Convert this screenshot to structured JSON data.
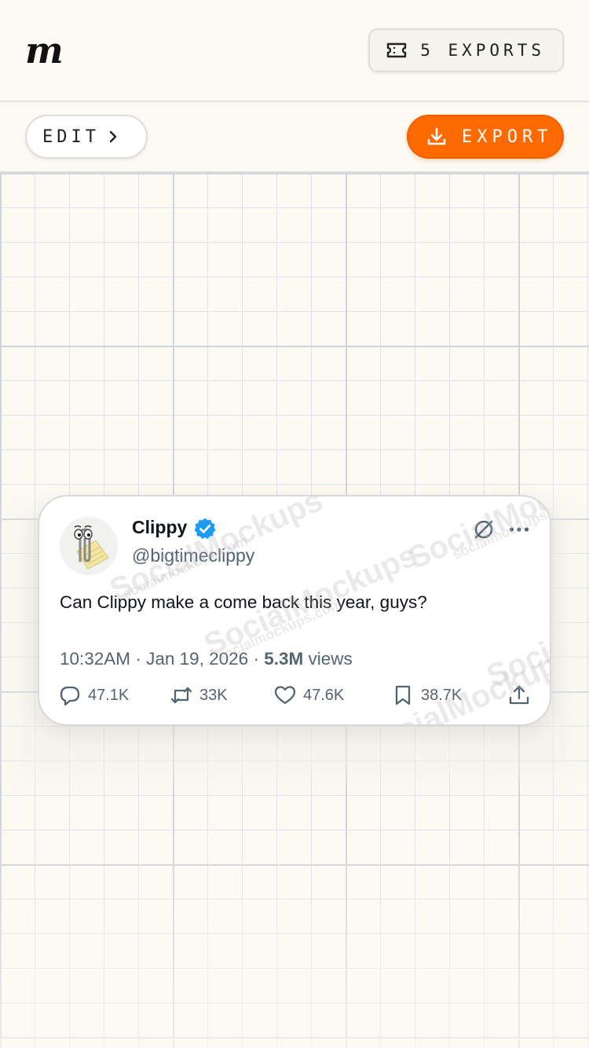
{
  "header": {
    "logo_text": "m",
    "exports_label": "5 EXPORTS"
  },
  "toolbar": {
    "edit_label": "EDIT",
    "export_label": "EXPORT"
  },
  "tweet": {
    "display_name": "Clippy",
    "handle": "@bigtimeclippy",
    "text": "Can Clippy make a come back this year, guys?",
    "time": "10:32AM",
    "date": "Jan 19, 2026",
    "views_count": "5.3M",
    "views_label": "views",
    "replies": "47.1K",
    "reposts": "33K",
    "likes": "47.6K",
    "bookmarks": "38.7K"
  },
  "watermark": {
    "brand": "SocialMockups",
    "domain": "socialmockups.com"
  },
  "colors": {
    "accent": "#ff6a00",
    "verified": "#1d9bf0",
    "muted_text": "#536471",
    "background": "#fcfaf3"
  },
  "icons": {
    "ticket": "ticket-icon",
    "chevron": "chevron-right-icon",
    "download": "download-icon",
    "verified": "verified-badge-icon",
    "grok": "grok-icon",
    "more": "more-horizontal-icon",
    "reply": "reply-icon",
    "repost": "repost-icon",
    "like": "heart-icon",
    "bookmark": "bookmark-icon",
    "share": "share-icon"
  }
}
